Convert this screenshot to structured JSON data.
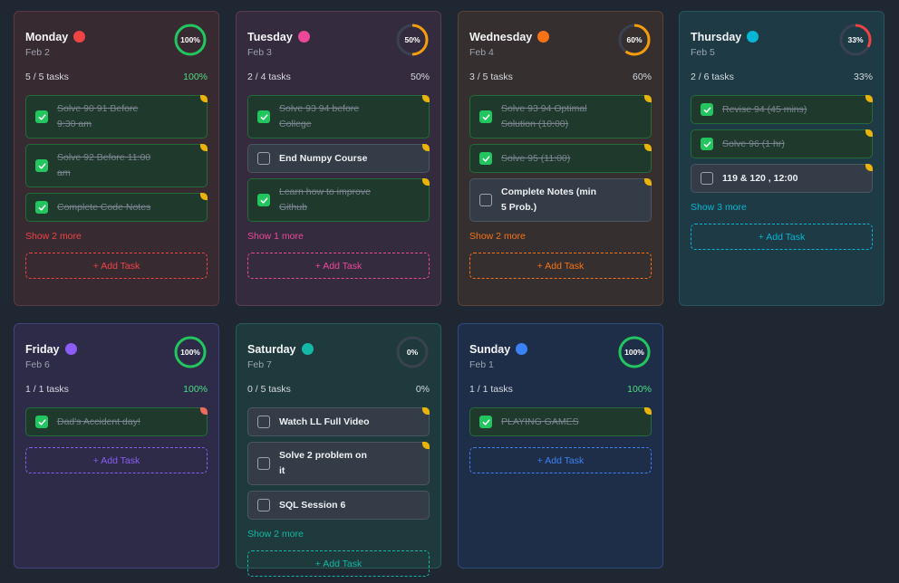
{
  "colors": {
    "green": "#22c55e",
    "ring_track": "#3a4250",
    "yellow_tag": "#eab308",
    "red_tag": "#ef6b5a"
  },
  "labels": {
    "tasks_suffix": "tasks",
    "show_more_word": "Show",
    "show_more_suffix": "more",
    "add_task": "+ Add Task"
  },
  "days": [
    {
      "name": "Monday",
      "date": "Feb 2",
      "accent": "#ef4444",
      "card_bg": "#382a31",
      "border": "#5b3a3f",
      "progress": 1.0,
      "progress_label": "100%",
      "ring_color": "#22c55e",
      "stats": "5 / 5 tasks",
      "percent": "100%",
      "show_more": "Show 2 more",
      "add_label": "+ Add Task",
      "tasks": [
        {
          "text": "Solve 90 91 Before 9:30 am",
          "done": true,
          "tag": "#eab308"
        },
        {
          "text": "Solve 92 Before 11:00 am",
          "done": true,
          "tag": "#eab308"
        },
        {
          "text": "Complete Code Notes",
          "done": true,
          "tag": "#eab308"
        }
      ]
    },
    {
      "name": "Tuesday",
      "date": "Feb 3",
      "accent": "#ec4899",
      "card_bg": "#352b3f",
      "border": "#5a3d55",
      "progress": 0.5,
      "progress_label": "50%",
      "ring_color": "#f59e0b",
      "stats": "2 / 4 tasks",
      "percent": "50%",
      "show_more": "Show 1 more",
      "add_label": "+ Add Task",
      "tasks": [
        {
          "text": "Solve 93 94 before College",
          "done": true,
          "tag": "#eab308"
        },
        {
          "text": "End Numpy Course",
          "done": false,
          "tag": "#eab308"
        },
        {
          "text": "Learn how to improve Github",
          "done": true,
          "tag": "#eab308"
        }
      ]
    },
    {
      "name": "Wednesday",
      "date": "Feb 4",
      "accent": "#f97316",
      "card_bg": "#352f2f",
      "border": "#5b4434",
      "progress": 0.6,
      "progress_label": "60%",
      "ring_color": "#f59e0b",
      "stats": "3 / 5 tasks",
      "percent": "60%",
      "show_more": "Show 2 more",
      "add_label": "+ Add Task",
      "tasks": [
        {
          "text": "Solve 93 94 Optimal Solution (10:00)",
          "done": true,
          "tag": "#eab308"
        },
        {
          "text": "Solve 95 (11:00)",
          "done": true,
          "tag": "#eab308"
        },
        {
          "text": "Complete Notes (min 5 Prob.)",
          "done": false,
          "tag": "#eab308"
        }
      ]
    },
    {
      "name": "Thursday",
      "date": "Feb 5",
      "accent": "#06b6d4",
      "card_bg": "#1e3a45",
      "border": "#285461",
      "progress": 0.33,
      "progress_label": "33%",
      "ring_color": "#ef4444",
      "stats": "2 / 6 tasks",
      "percent": "33%",
      "show_more": "Show 3 more",
      "add_label": "+ Add Task",
      "tasks": [
        {
          "text": "Revise 94 (45 mins)",
          "done": true,
          "tag": "#eab308"
        },
        {
          "text": "Solve 96 (1 hr)",
          "done": true,
          "tag": "#eab308"
        },
        {
          "text": "119 & 120 , 12:00",
          "done": false,
          "tag": "#eab308"
        }
      ]
    },
    {
      "name": "Friday",
      "date": "Feb 6",
      "accent": "#8b5cf6",
      "card_bg": "#2d2b48",
      "border": "#44407a",
      "progress": 1.0,
      "progress_label": "100%",
      "ring_color": "#22c55e",
      "stats": "1 / 1 tasks",
      "percent": "100%",
      "show_more": "",
      "add_label": "+ Add Task",
      "tasks": [
        {
          "text": "Dad's Accident day!",
          "done": true,
          "tag": "#ef6b5a"
        }
      ]
    },
    {
      "name": "Saturday",
      "date": "Feb 7",
      "accent": "#14b8a6",
      "card_bg": "#1f3a3c",
      "border": "#2a5a55",
      "progress": 0.0,
      "progress_label": "0%",
      "ring_color": "#22c55e",
      "stats": "0 / 5 tasks",
      "percent": "0%",
      "show_more": "Show 2 more",
      "add_label": "+ Add Task",
      "tasks": [
        {
          "text": "Watch LL Full Video",
          "done": false,
          "tag": "#eab308"
        },
        {
          "text": "Solve 2 problem on it",
          "done": false,
          "tag": "#eab308"
        },
        {
          "text": "SQL Session 6",
          "done": false,
          "tag": ""
        }
      ]
    },
    {
      "name": "Sunday",
      "date": "Feb 1",
      "accent": "#3b82f6",
      "card_bg": "#1f2e48",
      "border": "#2e4a78",
      "progress": 1.0,
      "progress_label": "100%",
      "ring_color": "#22c55e",
      "stats": "1 / 1 tasks",
      "percent": "100%",
      "show_more": "",
      "add_label": "+ Add Task",
      "tasks": [
        {
          "text": "PLAYING GAMES",
          "done": true,
          "tag": "#eab308"
        }
      ]
    }
  ]
}
